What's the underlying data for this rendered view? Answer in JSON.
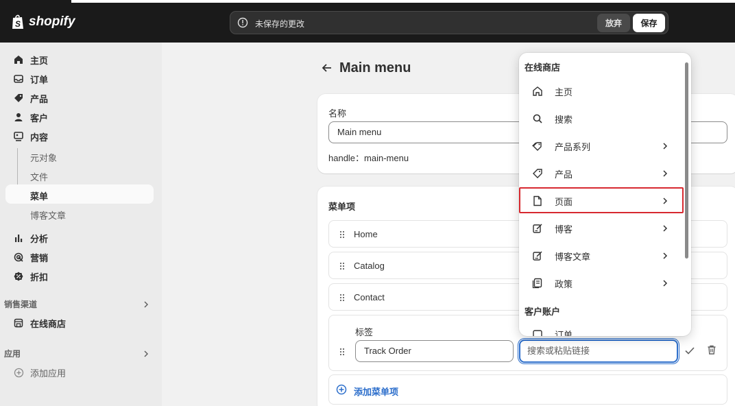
{
  "brand": {
    "name": "shopify"
  },
  "topbar": {
    "unsaved_text": "未保存的更改",
    "discard_label": "放弃",
    "save_label": "保存"
  },
  "sidebar": {
    "items": [
      {
        "label": "主页",
        "icon": "home-icon"
      },
      {
        "label": "订单",
        "icon": "inbox-icon"
      },
      {
        "label": "产品",
        "icon": "tag-icon"
      },
      {
        "label": "客户",
        "icon": "person-icon"
      },
      {
        "label": "内容",
        "icon": "content-icon"
      }
    ],
    "content_sub": [
      "元对象",
      "文件",
      "菜单",
      "博客文章"
    ],
    "items2": [
      {
        "label": "分析",
        "icon": "bar-chart-icon"
      },
      {
        "label": "营销",
        "icon": "target-icon"
      },
      {
        "label": "折扣",
        "icon": "discount-icon"
      }
    ],
    "sales_channels_title": "销售渠道",
    "online_store_label": "在线商店",
    "apps_title": "应用",
    "add_app_label": "添加应用"
  },
  "main": {
    "title": "Main menu",
    "name_label": "名称",
    "name_value": "Main menu",
    "handle_text": "handle：main-menu",
    "menu_items_title": "菜单项",
    "menu_items": [
      "Home",
      "Catalog",
      "Contact"
    ],
    "edit_row": {
      "label_title": "标签",
      "label_value": "Track Order",
      "link_placeholder": "搜索或粘贴链接"
    },
    "add_item_label": "添加菜单项"
  },
  "popover": {
    "section1": "在线商店",
    "items": [
      {
        "label": "主页",
        "icon": "home-icon",
        "has_children": false
      },
      {
        "label": "搜索",
        "icon": "search-icon",
        "has_children": false
      },
      {
        "label": "产品系列",
        "icon": "collection-tag-icon",
        "has_children": true
      },
      {
        "label": "产品",
        "icon": "tag-icon",
        "has_children": true
      },
      {
        "label": "页面",
        "icon": "page-icon",
        "has_children": true,
        "highlighted": true
      },
      {
        "label": "博客",
        "icon": "blog-icon",
        "has_children": true
      },
      {
        "label": "博客文章",
        "icon": "blog-post-icon",
        "has_children": true
      },
      {
        "label": "政策",
        "icon": "policy-icon",
        "has_children": true
      }
    ],
    "section2": "客户账户",
    "partial_item": "订单"
  },
  "colors": {
    "topbar": "#1a1a1a",
    "accent": "#2c6ecb",
    "highlight_border": "#d7282f"
  }
}
